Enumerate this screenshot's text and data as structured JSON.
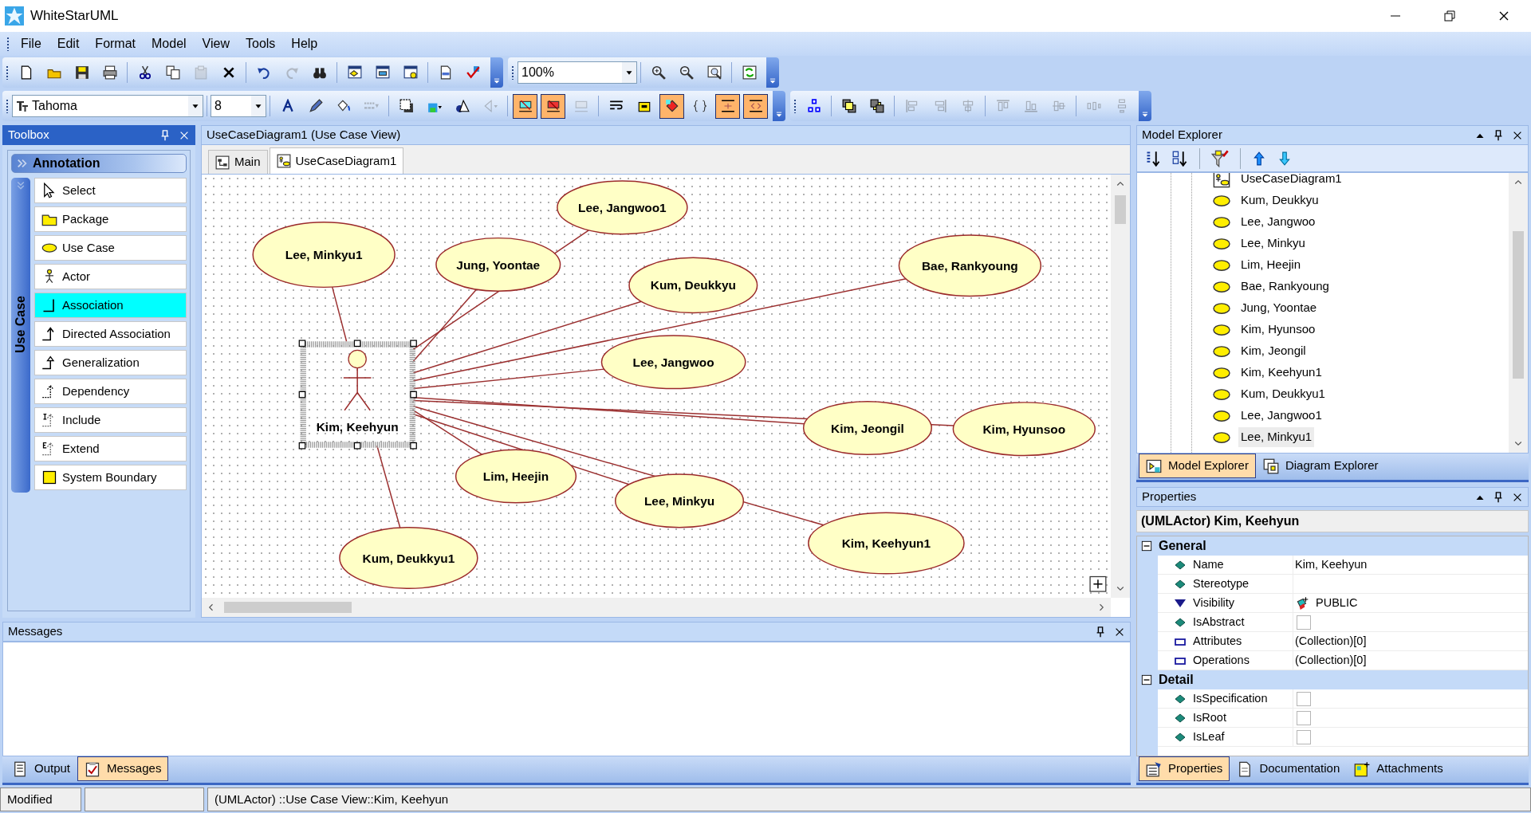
{
  "window": {
    "title": "WhiteStarUML"
  },
  "menu": [
    {
      "label": "File"
    },
    {
      "label": "Edit"
    },
    {
      "label": "Format"
    },
    {
      "label": "Model"
    },
    {
      "label": "View"
    },
    {
      "label": "Tools"
    },
    {
      "label": "Help"
    }
  ],
  "toolbars": [
    {
      "groups": [
        [
          {
            "disabled": false
          },
          {
            "disabled": false
          },
          {
            "disabled": false
          },
          {
            "disabled": false
          }
        ],
        [
          {
            "disabled": false
          },
          {
            "disabled": false
          },
          {
            "disabled": true
          },
          {
            "disabled": false
          }
        ],
        [
          {
            "disabled": false
          },
          {
            "disabled": true
          },
          {
            "disabled": false
          }
        ],
        [
          {
            "disabled": false
          },
          {
            "disabled": false
          },
          {
            "disabled": false
          }
        ],
        [
          {
            "disabled": false
          },
          {
            "disabled": false
          }
        ]
      ]
    },
    {
      "combos": [
        {
          "value": "100%"
        }
      ],
      "groups": [
        [
          {
            "disabled": false
          },
          {
            "disabled": false
          },
          {
            "disabled": false
          }
        ],
        [
          {
            "disabled": false
          }
        ]
      ]
    },
    {
      "combos": [
        {
          "value": "Tahoma"
        },
        {
          "value": "8"
        }
      ],
      "groups": [
        [
          {
            "disabled": false,
            "pressed": false
          },
          {
            "disabled": false,
            "pressed": false
          },
          {
            "disabled": false,
            "pressed": false
          },
          {
            "disabled": true,
            "pressed": false
          }
        ],
        [
          {
            "disabled": false,
            "pressed": false
          },
          {
            "disabled": false,
            "pressed": false
          },
          {
            "disabled": false,
            "pressed": false
          },
          {
            "disabled": true,
            "pressed": false
          }
        ],
        [
          {
            "disabled": false,
            "pressed": true
          },
          {
            "disabled": false,
            "pressed": true
          },
          {
            "disabled": true,
            "pressed": false
          }
        ],
        [
          {
            "disabled": false,
            "pressed": false
          },
          {
            "disabled": false,
            "pressed": false
          },
          {
            "disabled": false,
            "pressed": true
          },
          {
            "disabled": false,
            "pressed": false
          },
          {
            "disabled": false,
            "pressed": true
          },
          {
            "disabled": false,
            "pressed": true
          }
        ]
      ]
    },
    {
      "groups": [
        [
          {
            "disabled": false
          }
        ],
        [
          {
            "disabled": false
          },
          {
            "disabled": false
          }
        ],
        [
          {
            "disabled": true
          },
          {
            "disabled": true
          },
          {
            "disabled": true
          }
        ],
        [
          {
            "disabled": true
          },
          {
            "disabled": true
          },
          {
            "disabled": true
          }
        ],
        [
          {
            "disabled": true
          },
          {
            "disabled": true
          }
        ]
      ]
    }
  ],
  "toolbox": {
    "title": "Toolbox",
    "group": "Annotation",
    "section": "Use Case",
    "items": [
      {
        "label": "Select",
        "selected": false
      },
      {
        "label": "Package",
        "selected": false
      },
      {
        "label": "Use Case",
        "selected": false
      },
      {
        "label": "Actor",
        "selected": false
      },
      {
        "label": "Association",
        "selected": true
      },
      {
        "label": "Directed Association",
        "selected": false
      },
      {
        "label": "Generalization",
        "selected": false
      },
      {
        "label": "Dependency",
        "selected": false
      },
      {
        "label": "Include",
        "selected": false
      },
      {
        "label": "Extend",
        "selected": false
      },
      {
        "label": "System Boundary",
        "selected": false
      }
    ]
  },
  "document": {
    "title": "UseCaseDiagram1 (Use Case View)",
    "tabs": [
      {
        "label": "Main",
        "selected": false
      },
      {
        "label": "UseCaseDiagram1",
        "selected": true
      }
    ]
  },
  "diagram": {
    "actor": {
      "name": "Kim, Keehyun",
      "selected": true
    },
    "use_cases": [
      {
        "name": "Lee, Jangwoo1"
      },
      {
        "name": "Lee, Minkyu1"
      },
      {
        "name": "Jung, Yoontae"
      },
      {
        "name": "Bae, Rankyoung"
      },
      {
        "name": "Kum, Deukkyu"
      },
      {
        "name": "Lee, Jangwoo"
      },
      {
        "name": "Kim, Jeongil"
      },
      {
        "name": "Kim, Hyunsoo"
      },
      {
        "name": "Lim, Heejin"
      },
      {
        "name": "Lee, Minkyu"
      },
      {
        "name": "Kim, Keehyun1"
      },
      {
        "name": "Kum, Deukkyu1"
      }
    ]
  },
  "model_explorer": {
    "title": "Model Explorer",
    "items": [
      {
        "label": "UseCaseDiagram1",
        "kind": "diagram",
        "selected": false
      },
      {
        "label": "Kum, Deukkyu",
        "kind": "use_case",
        "selected": false
      },
      {
        "label": "Lee, Jangwoo",
        "kind": "use_case",
        "selected": false
      },
      {
        "label": "Lee, Minkyu",
        "kind": "use_case",
        "selected": false
      },
      {
        "label": "Lim, Heejin",
        "kind": "use_case",
        "selected": false
      },
      {
        "label": "Bae, Rankyoung",
        "kind": "use_case",
        "selected": false
      },
      {
        "label": "Jung, Yoontae",
        "kind": "use_case",
        "selected": false
      },
      {
        "label": "Kim, Hyunsoo",
        "kind": "use_case",
        "selected": false
      },
      {
        "label": "Kim, Jeongil",
        "kind": "use_case",
        "selected": false
      },
      {
        "label": "Kim, Keehyun1",
        "kind": "use_case",
        "selected": false
      },
      {
        "label": "Kum, Deukkyu1",
        "kind": "use_case",
        "selected": false
      },
      {
        "label": "Lee, Jangwoo1",
        "kind": "use_case",
        "selected": false
      },
      {
        "label": "Lee, Minkyu1",
        "kind": "use_case",
        "selected": true
      }
    ],
    "tabs": [
      {
        "label": "Model Explorer",
        "selected": true
      },
      {
        "label": "Diagram Explorer",
        "selected": false
      }
    ]
  },
  "properties": {
    "title": "Properties",
    "heading": "(UMLActor) Kim, Keehyun",
    "groups": [
      {
        "name": "General",
        "expanded": true,
        "rows": [
          {
            "name": "Name",
            "kind": "attribute",
            "value": "Kim, Keehyun"
          },
          {
            "name": "Stereotype",
            "kind": "attribute"
          },
          {
            "name": "Visibility",
            "kind": "enum",
            "value": "PUBLIC"
          },
          {
            "name": "IsAbstract",
            "kind": "attribute",
            "checked": false
          },
          {
            "name": "Attributes",
            "kind": "collection",
            "value": "(Collection)[0]"
          },
          {
            "name": "Operations",
            "kind": "collection",
            "value": "(Collection)[0]"
          }
        ]
      },
      {
        "name": "Detail",
        "expanded": true,
        "rows": [
          {
            "name": "IsSpecification",
            "kind": "attribute",
            "checked": false
          },
          {
            "name": "IsRoot",
            "kind": "attribute",
            "checked": false
          },
          {
            "name": "IsLeaf",
            "kind": "attribute",
            "checked": false
          }
        ]
      }
    ],
    "tabs": [
      {
        "label": "Properties",
        "selected": true
      },
      {
        "label": "Documentation",
        "selected": false
      },
      {
        "label": "Attachments",
        "selected": false
      }
    ]
  },
  "messages": {
    "title": "Messages",
    "tabs": [
      {
        "label": "Output",
        "selected": false
      },
      {
        "label": "Messages",
        "selected": true
      }
    ]
  },
  "status_bar": {
    "state": "Modified",
    "path": "(UMLActor) ::Use Case View::Kim, Keehyun"
  }
}
